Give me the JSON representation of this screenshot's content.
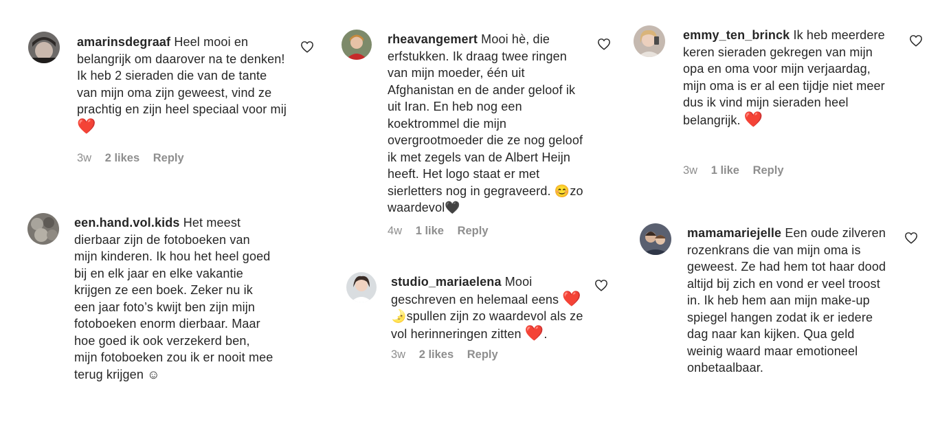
{
  "comments": [
    {
      "username": "amarinsdegraaf",
      "text": "Heel mooi en belangrijk om daarover na te denken! Ik heb 2 sieraden die van de tante van mijn oma zijn geweest, vind ze prachtig en zijn heel speciaal voor mij",
      "emoji": "❤️",
      "time": "3w",
      "likes": "2 likes",
      "reply": "Reply"
    },
    {
      "username": "een.hand.vol.kids",
      "text": "Het meest dierbaar zijn de fotoboeken van mijn kinderen. Ik hou het heel goed bij en elk jaar en elke vakantie krijgen ze een boek. Zeker nu ik een jaar foto’s kwijt ben zijn mijn fotoboeken enorm dierbaar. Maar hoe goed ik ook verzekerd ben, mijn fotoboeken zou ik er nooit mee terug krijgen",
      "emoji": "☺"
    },
    {
      "username": "rheavangemert",
      "text": "Mooi hè, die erfstukken. Ik draag twee ringen van mijn moeder, één uit Afghanistan en de ander geloof ik uit Iran. En heb nog een koektrommel die mijn overgrootmoeder die ze nog geloof ik met zegels van de Albert Heijn heeft. Het logo staat er met sierletters nog in gegraveerd.",
      "emoji_a": "😊",
      "text_b": "zo waardevol",
      "emoji_b": "🖤",
      "time": "4w",
      "likes": "1 like",
      "reply": "Reply"
    },
    {
      "username": "studio_mariaelena",
      "text": "Mooi geschreven en helemaal eens",
      "emoji_a": "❤️",
      "emoji_b": "🌛",
      "text_b": "spullen zijn zo waardevol als ze vol herinneringen zitten",
      "emoji_c": "❤️",
      "text_c": ".",
      "time": "3w",
      "likes": "2 likes",
      "reply": "Reply"
    },
    {
      "username": "emmy_ten_brinck",
      "text": "Ik heb meerdere keren sieraden gekregen van mijn opa en oma voor mijn verjaardag, mijn oma is er al een tijdje niet meer dus ik vind mijn sieraden heel belangrijk.",
      "emoji": "❤️",
      "time": "3w",
      "likes": "1 like",
      "reply": "Reply"
    },
    {
      "username": "mamamariejelle",
      "text": "Een oude zilveren rozenkrans die van mijn oma is geweest. Ze had hem tot haar dood altijd bij zich en vond er veel troost in. Ik heb hem aan mijn make-up spiegel hangen zodat ik er iedere dag naar kan kijken. Qua geld weinig waard maar emotioneel onbetaalbaar."
    }
  ]
}
